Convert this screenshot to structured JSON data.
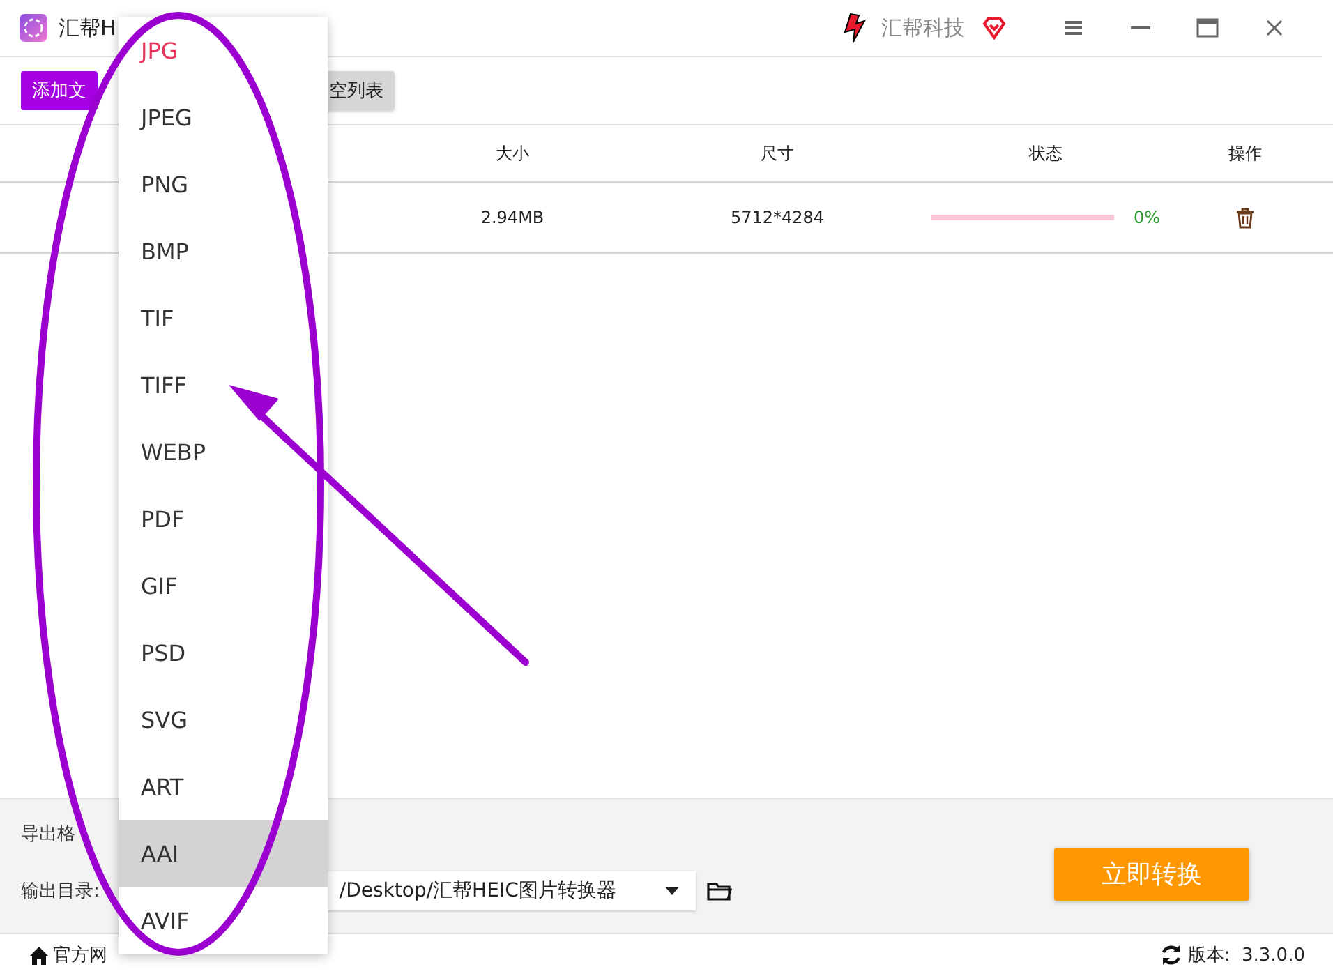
{
  "window": {
    "title": "汇帮H",
    "brand": "汇帮科技"
  },
  "toolbar": {
    "add_button": "添加文",
    "clear_button": "空列表"
  },
  "table": {
    "columns": [
      "大小",
      "尺寸",
      "状态",
      "操作"
    ],
    "rows": [
      {
        "size": "2.94MB",
        "dimensions": "5712*4284",
        "level": 0,
        "percent": "0%"
      }
    ]
  },
  "settings": {
    "format_label": "导出格",
    "dir_label": "输出目录:",
    "dir_value": "/Desktop/汇帮HEIC图片转换器",
    "convert_button": "立即转换"
  },
  "footer": {
    "website_link": "官方网",
    "version": "版本:  3.3.0.0"
  },
  "format_menu": [
    {
      "label": "JPG",
      "selected": false,
      "current": true
    },
    {
      "label": "JPEG",
      "selected": false,
      "current": false
    },
    {
      "label": "PNG",
      "selected": false,
      "current": false
    },
    {
      "label": "BMP",
      "selected": false,
      "current": false
    },
    {
      "label": "TIF",
      "selected": false,
      "current": false
    },
    {
      "label": "TIFF",
      "selected": false,
      "current": false
    },
    {
      "label": "WEBP",
      "selected": false,
      "current": false
    },
    {
      "label": "PDF",
      "selected": false,
      "current": false
    },
    {
      "label": "GIF",
      "selected": false,
      "current": false
    },
    {
      "label": "PSD",
      "selected": false,
      "current": false
    },
    {
      "label": "SVG",
      "selected": false,
      "current": false
    },
    {
      "label": "ART",
      "selected": false,
      "current": false
    },
    {
      "label": "AAI",
      "selected": true,
      "current": false
    },
    {
      "label": "AVIF",
      "selected": false,
      "current": false
    }
  ]
}
